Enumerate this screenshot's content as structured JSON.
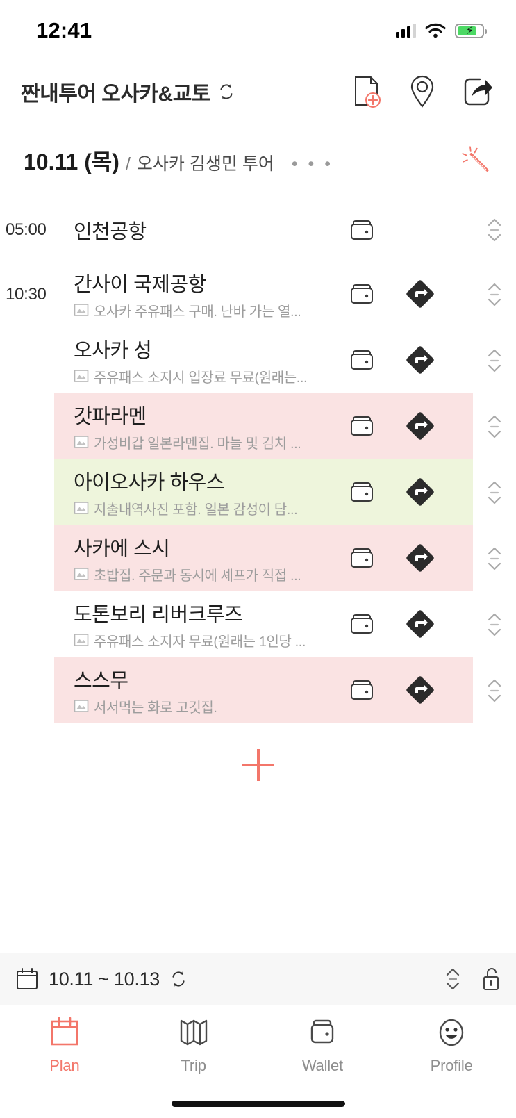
{
  "statusbar": {
    "time": "12:41",
    "signal_icon": "cellular-signal-icon",
    "wifi_icon": "wifi-icon",
    "battery_icon": "battery-charging-icon"
  },
  "titlebar": {
    "trip_title": "짠내투어 오사카&교토",
    "sync_icon": "sync-icon",
    "actions": [
      {
        "name": "add-document-button",
        "icon": "document-add-icon"
      },
      {
        "name": "map-pin-button",
        "icon": "map-pin-icon"
      },
      {
        "name": "share-button",
        "icon": "share-icon"
      }
    ]
  },
  "day_header": {
    "date": "10.11 (목)",
    "separator": "/",
    "name": "오사카 김생민 투어",
    "more": "• • •",
    "magic_icon": "magic-wand-icon"
  },
  "list": {
    "items": [
      {
        "time": "05:00",
        "place": "인천공항",
        "desc": "",
        "highlight": "none",
        "wallet": true,
        "nav": false
      },
      {
        "time": "10:30",
        "place": "간사이 국제공항",
        "desc": "오사카 주유패스 구매. 난바 가는 열...",
        "highlight": "none",
        "wallet": true,
        "nav": true
      },
      {
        "time": "",
        "place": "오사카 성",
        "desc": "주유패스 소지시 입장료 무료(원래는...",
        "highlight": "none",
        "wallet": true,
        "nav": true
      },
      {
        "time": "",
        "place": "갓파라멘",
        "desc": "가성비갑 일본라멘집. 마늘 및 김치 ...",
        "highlight": "pink",
        "wallet": true,
        "nav": true
      },
      {
        "time": "",
        "place": "아이오사카 하우스",
        "desc": "지출내역사진 포함. 일본 감성이 담...",
        "highlight": "green",
        "wallet": true,
        "nav": true
      },
      {
        "time": "",
        "place": "사카에 스시",
        "desc": "초밥집. 주문과 동시에 셰프가 직접 ...",
        "highlight": "pink",
        "wallet": true,
        "nav": true
      },
      {
        "time": "",
        "place": "도톤보리 리버크루즈",
        "desc": "주유패스 소지자 무료(원래는 1인당 ...",
        "highlight": "none",
        "wallet": true,
        "nav": true
      },
      {
        "time": "",
        "place": "스스무",
        "desc": "서서먹는 화로 고깃집.",
        "highlight": "pink",
        "wallet": true,
        "nav": true
      }
    ],
    "add_label": "+",
    "photo_icon": "photo-memo-icon",
    "wallet_icon": "wallet-icon",
    "nav_icon": "navigation-directions-icon",
    "reorder_icon": "reorder-handle-icon"
  },
  "toolbar": {
    "calendar_icon": "calendar-icon",
    "date_range": "10.11 ~ 10.13",
    "sync_icon": "sync-icon",
    "sort_icon": "sort-updown-icon",
    "lock_icon": "unlock-icon"
  },
  "tabbar": {
    "tabs": [
      {
        "label": "Plan",
        "icon": "calendar-icon",
        "active": true
      },
      {
        "label": "Trip",
        "icon": "map-icon",
        "active": false
      },
      {
        "label": "Wallet",
        "icon": "wallet-icon",
        "active": false
      },
      {
        "label": "Profile",
        "icon": "smiley-face-icon",
        "active": false
      }
    ]
  },
  "colors": {
    "accent": "#f3766a",
    "pink_row": "#fae3e3",
    "green_row": "#eef5dc",
    "muted": "#9d9d9d",
    "toolbar_bg": "#f7f7f7"
  }
}
